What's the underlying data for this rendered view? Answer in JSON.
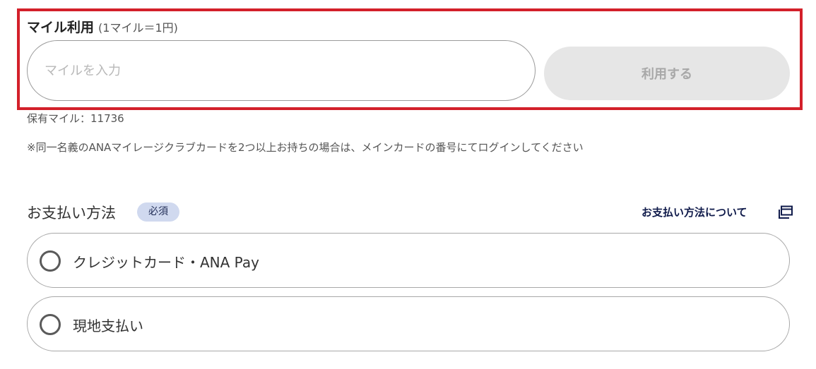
{
  "mile_use": {
    "title": "マイル利用",
    "rate_note": "(1マイル＝1円)",
    "input_placeholder": "マイルを入力",
    "input_value": "",
    "use_button_label": "利用する",
    "held_miles_text": "保有マイル：11736",
    "notice_text": "※同一名義のANAマイレージクラブカードを2つ以上お持ちの場合は、メインカードの番号にてログインしてください",
    "highlight_color": "#d3202a"
  },
  "payment": {
    "title": "お支払い方法",
    "required_badge": "必須",
    "info_link_label": "お支払い方法について",
    "info_link_icon": "external-window-icon",
    "options": [
      {
        "label": "クレジットカード・ANA Pay",
        "selected": false
      },
      {
        "label": "現地支払い",
        "selected": false
      }
    ]
  }
}
